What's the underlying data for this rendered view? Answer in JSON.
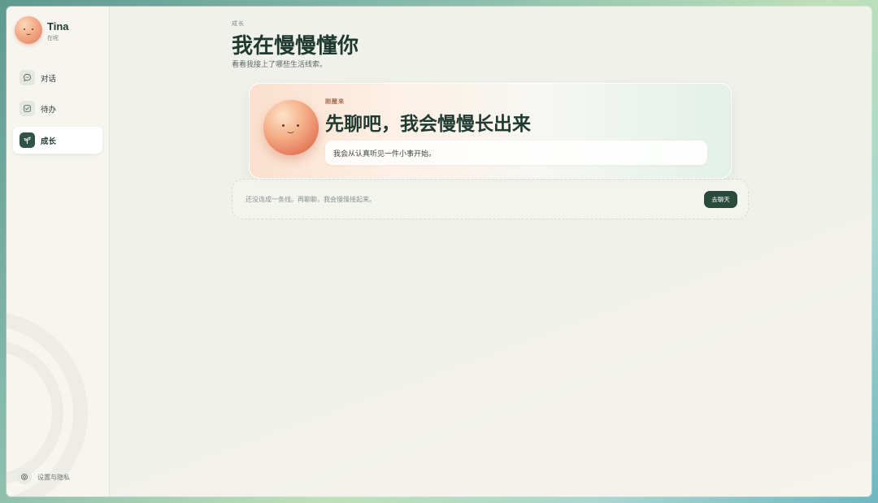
{
  "profile": {
    "name": "Tina",
    "status": "在呢"
  },
  "sidebar": {
    "items": [
      {
        "label": "对话",
        "icon": "chat-bubble-icon",
        "active": false
      },
      {
        "label": "待办",
        "icon": "checkbox-icon",
        "active": false
      },
      {
        "label": "成长",
        "icon": "sprout-icon",
        "active": true
      }
    ],
    "settings_label": "设置与隐私",
    "settings_icon": "gear-icon"
  },
  "page": {
    "eyebrow": "成长",
    "title": "我在慢慢懂你",
    "subtitle": "看看我接上了哪些生活线索。"
  },
  "hero": {
    "eyebrow": "刚醒来",
    "title": "先聊吧，我会慢慢长出来",
    "note": "我会从认真听见一件小事开始。"
  },
  "empty_state": {
    "text": "还没连成一条线。再聊聊，我会慢慢接起来。",
    "button_label": "去聊天"
  },
  "colors": {
    "accent": "#2b4a3e",
    "title": "#1e3a30",
    "avatar": "#f3ab86"
  }
}
